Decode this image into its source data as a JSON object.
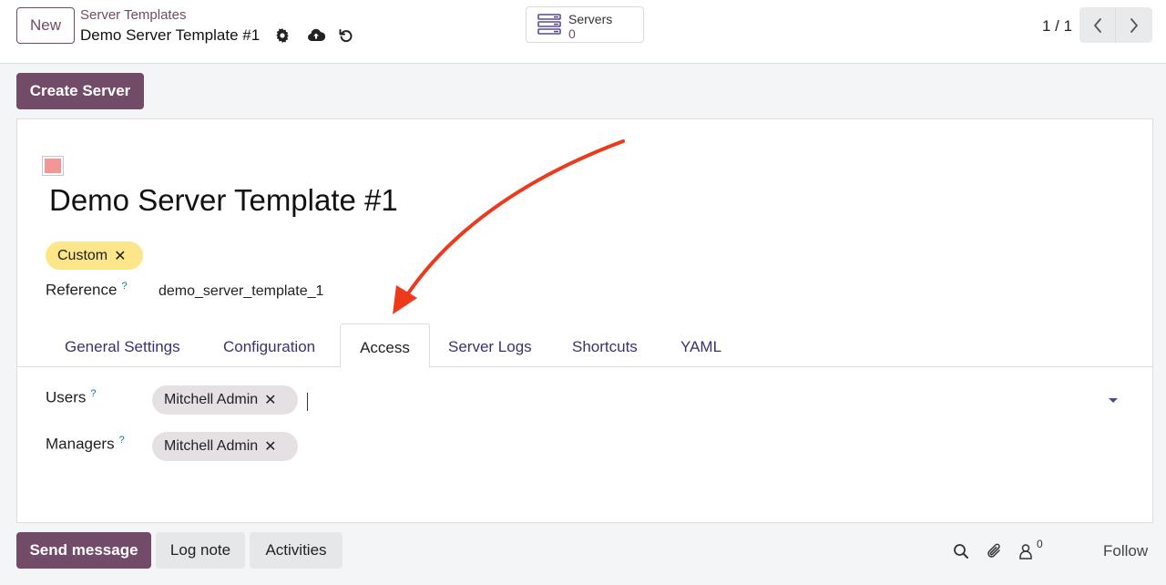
{
  "control_panel": {
    "new_label": "New",
    "breadcrumb_parent": "Server Templates",
    "record_title": "Demo Server Template #1",
    "smart_button": {
      "label": "Servers",
      "value": "0"
    },
    "pager_value": "1 / 1"
  },
  "status_bar": {
    "create_server_label": "Create Server"
  },
  "form": {
    "name": "Demo Server Template #1",
    "color": "#f49598",
    "tags": [
      {
        "label": "Custom",
        "color": "#fde68a"
      }
    ],
    "reference_label": "Reference",
    "reference_value": "demo_server_template_1",
    "help_mark": "?",
    "tabs": [
      {
        "label": "General Settings",
        "active": false
      },
      {
        "label": "Configuration",
        "active": false
      },
      {
        "label": "Access",
        "active": true
      },
      {
        "label": "Server Logs",
        "active": false
      },
      {
        "label": "Shortcuts",
        "active": false
      },
      {
        "label": "YAML",
        "active": false
      }
    ],
    "access": {
      "users_label": "Users",
      "users": [
        "Mitchell Admin"
      ],
      "managers_label": "Managers",
      "managers": [
        "Mitchell Admin"
      ]
    }
  },
  "chatter": {
    "send_message_label": "Send message",
    "log_note_label": "Log note",
    "activities_label": "Activities",
    "followers_count": "0",
    "follow_label": "Follow"
  },
  "colors": {
    "brand": "#714b67",
    "annotation_arrow": "#ee3a1c"
  }
}
